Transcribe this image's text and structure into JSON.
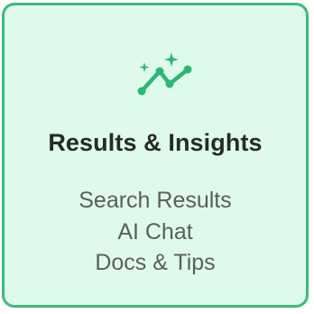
{
  "card": {
    "icon": "sparkle-trend-icon",
    "title": "Results & Insights",
    "items": [
      {
        "label": "Search Results"
      },
      {
        "label": "AI Chat"
      },
      {
        "label": "Docs & Tips"
      }
    ]
  },
  "colors": {
    "accent": "#2bb673",
    "border": "#3dbb7c",
    "background": "#dffaea",
    "title": "#262b29",
    "text": "#5a5f5c"
  }
}
